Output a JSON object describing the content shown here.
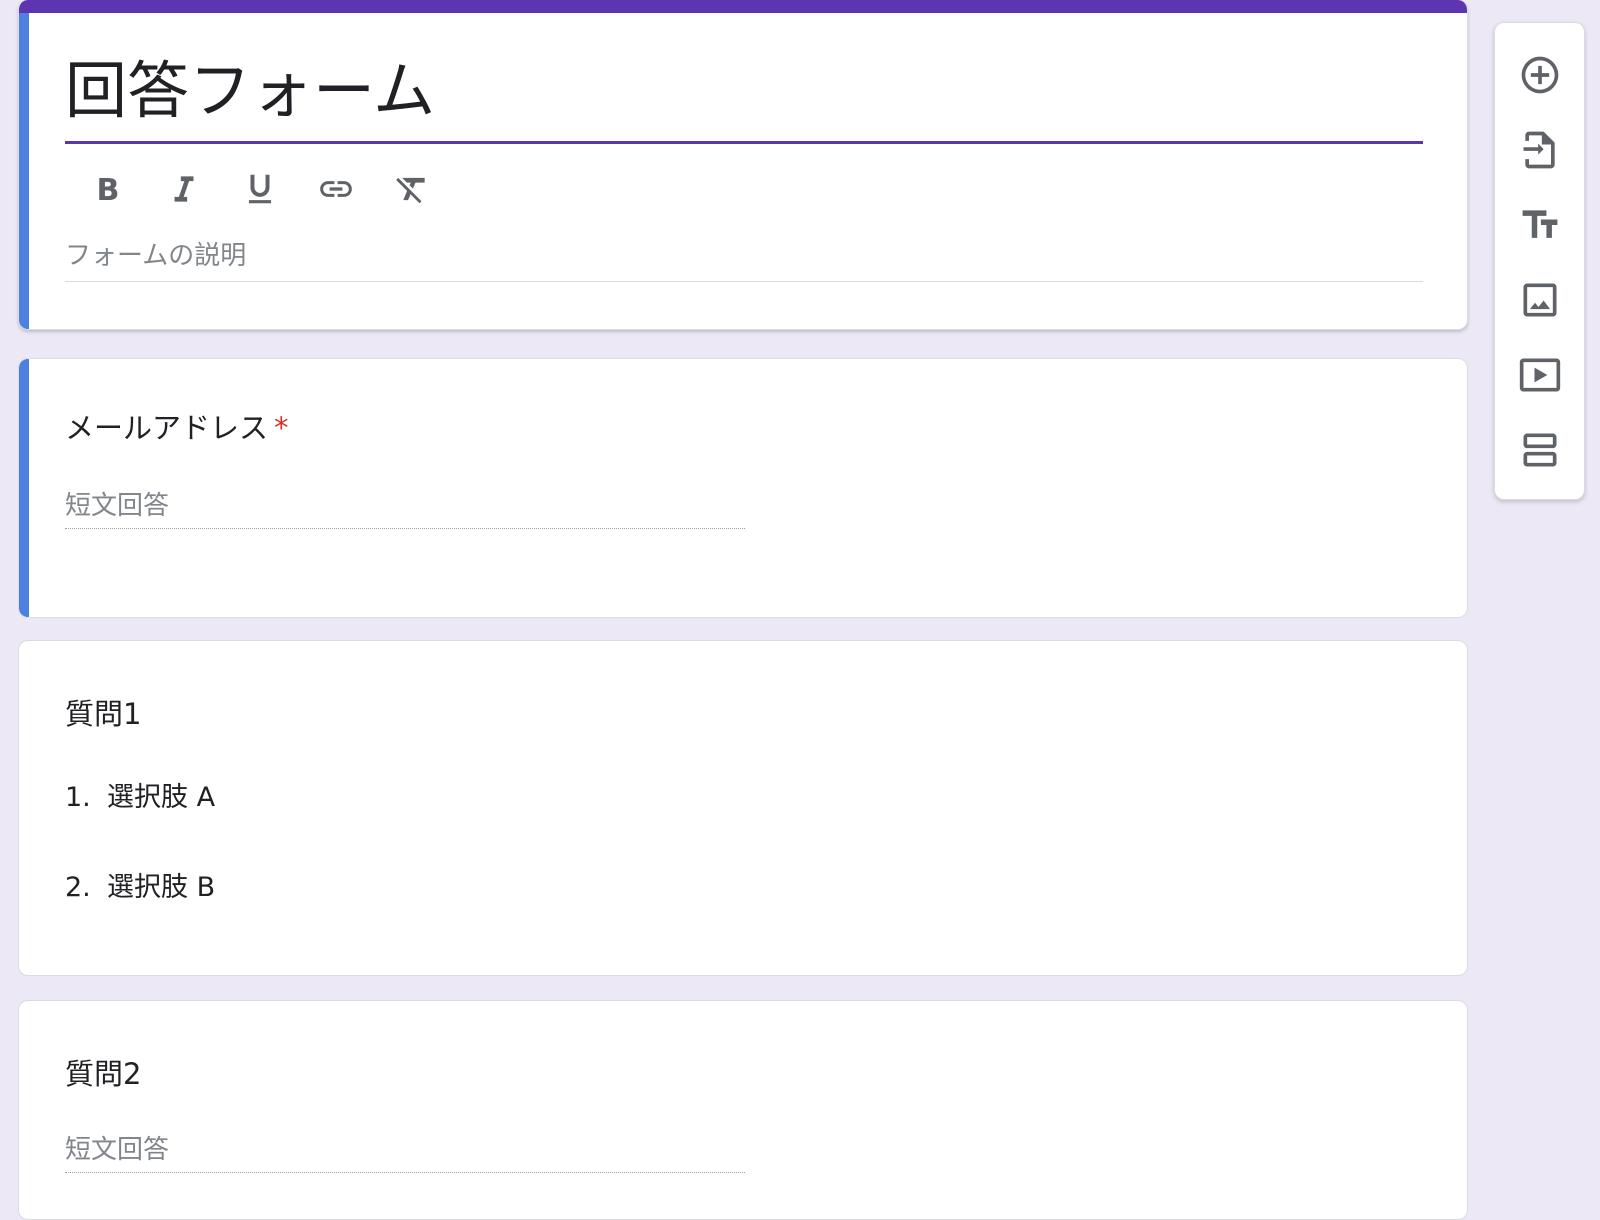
{
  "form": {
    "title": "回答フォーム",
    "description_placeholder": "フォームの説明",
    "format_toolbar": [
      {
        "name": "bold-icon",
        "glyph": "B"
      },
      {
        "name": "italic-icon",
        "glyph": "I"
      },
      {
        "name": "underline-icon",
        "glyph": "U"
      },
      {
        "name": "link-icon"
      },
      {
        "name": "clear-format-icon"
      }
    ]
  },
  "questions": [
    {
      "title": "メールアドレス",
      "required_mark": "*",
      "answer_placeholder": "短文回答"
    },
    {
      "title": "質問1",
      "options": [
        {
          "number": "1.",
          "label": "選択肢 A"
        },
        {
          "number": "2.",
          "label": "選択肢 B"
        }
      ]
    },
    {
      "title": "質問2",
      "answer_placeholder": "短文回答"
    }
  ],
  "side_toolbar": [
    {
      "name": "add-question-icon"
    },
    {
      "name": "import-questions-icon"
    },
    {
      "name": "add-title-icon"
    },
    {
      "name": "add-image-icon"
    },
    {
      "name": "add-video-icon"
    },
    {
      "name": "add-section-icon"
    }
  ],
  "colors": {
    "page_background": "#ede8f6",
    "theme_accent": "#5e35b1",
    "active_indicator": "#4f7fe0",
    "required_mark": "#d93025",
    "icon_gray": "#5f6368"
  }
}
